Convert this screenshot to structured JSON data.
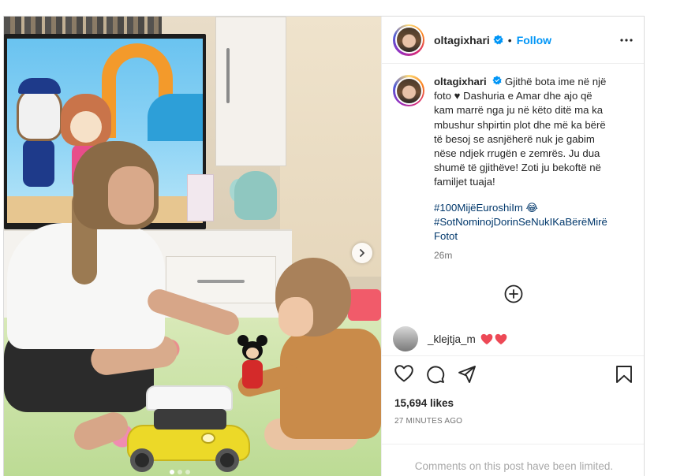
{
  "post": {
    "username": "oltagixhari",
    "separator": "•",
    "follow_label": "Follow",
    "caption_lines": [
      "Gjithë bota ime në një",
      "foto ♥ Dashuria e Amar dhe ajo që",
      "kam marrë nga ju në këto ditë ma ka",
      "mbushur shpirtin plot dhe më ka bërë",
      "të besoj se asnjëherë nuk je gabim",
      "nëse ndjek rrugën e zemrës. Ju dua",
      "shumë të gjithëve! Zoti ju bekoftë në",
      "familjet tuaja!"
    ],
    "hashtags": [
      "#100MijëEuroshiIm 😂",
      "#SotNominojDorinSeNukIKaBërëMirë",
      "Fotot"
    ],
    "caption_age": "26m",
    "comment": {
      "username": "_klejtja_m"
    },
    "likes": "15,694 likes",
    "time_ago": "27 MINUTES AGO",
    "comments_limited": "Comments on this post have been limited.",
    "carousel": {
      "total": 3,
      "active": 1
    }
  },
  "icons": {
    "verified": "verified-badge-icon",
    "more": "more-options-icon",
    "next": "chevron-right-icon",
    "add": "add-circle-icon",
    "like": "heart-icon",
    "comment": "comment-icon",
    "share": "share-icon",
    "save": "bookmark-icon"
  },
  "colors": {
    "accent": "#0095f6",
    "hashtag": "#00376b",
    "heart": "#ed4956"
  }
}
